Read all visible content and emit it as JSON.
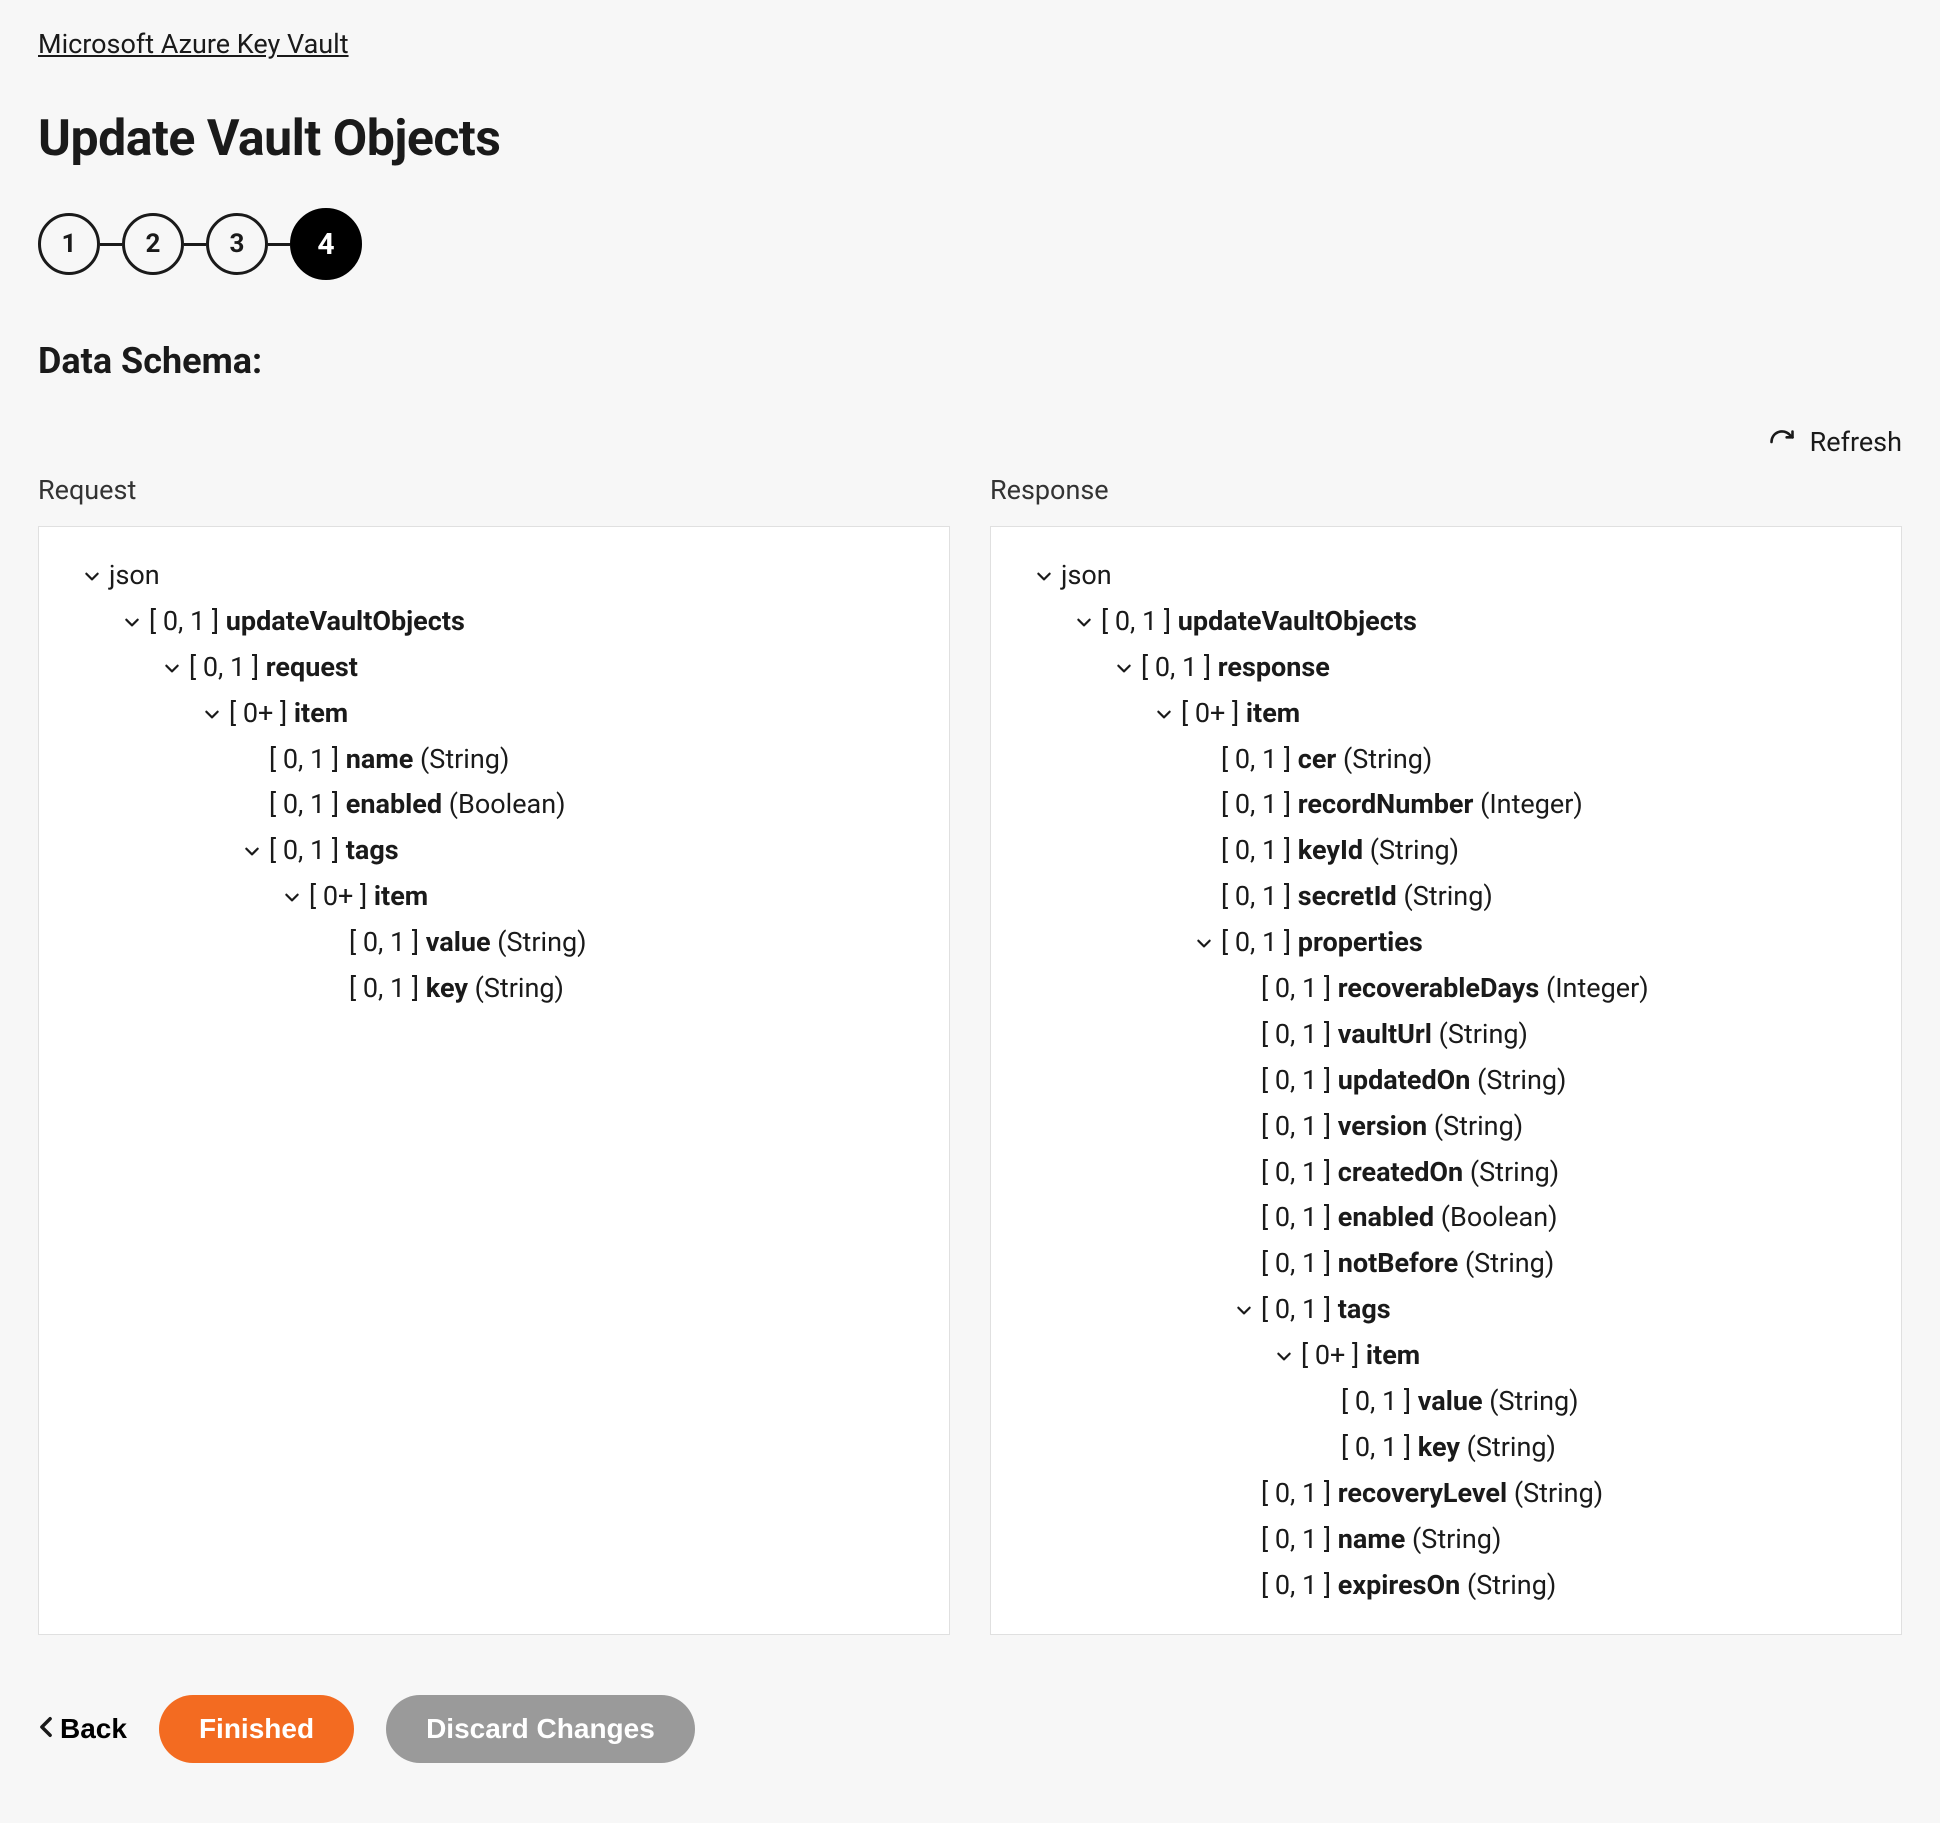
{
  "breadcrumb": "Microsoft Azure Key Vault",
  "page_title": "Update Vault Objects",
  "stepper": {
    "steps": [
      "1",
      "2",
      "3",
      "4"
    ],
    "active_index": 3
  },
  "section_heading": "Data Schema:",
  "refresh_label": "Refresh",
  "columns": {
    "request": {
      "header": "Request",
      "tree": [
        {
          "indent": 0,
          "chevron": true,
          "card": "",
          "name": "json",
          "type": ""
        },
        {
          "indent": 1,
          "chevron": true,
          "card": "[ 0, 1 ]",
          "name": "updateVaultObjects",
          "type": ""
        },
        {
          "indent": 2,
          "chevron": true,
          "card": "[ 0, 1 ]",
          "name": "request",
          "type": ""
        },
        {
          "indent": 3,
          "chevron": true,
          "card": "[ 0+ ]",
          "name": "item",
          "type": ""
        },
        {
          "indent": 4,
          "chevron": false,
          "card": "[ 0, 1 ]",
          "name": "name",
          "type": "(String)"
        },
        {
          "indent": 4,
          "chevron": false,
          "card": "[ 0, 1 ]",
          "name": "enabled",
          "type": "(Boolean)"
        },
        {
          "indent": 4,
          "chevron": true,
          "card": "[ 0, 1 ]",
          "name": "tags",
          "type": ""
        },
        {
          "indent": 5,
          "chevron": true,
          "card": "[ 0+ ]",
          "name": "item",
          "type": ""
        },
        {
          "indent": 6,
          "chevron": false,
          "card": "[ 0, 1 ]",
          "name": "value",
          "type": "(String)"
        },
        {
          "indent": 6,
          "chevron": false,
          "card": "[ 0, 1 ]",
          "name": "key",
          "type": "(String)"
        }
      ]
    },
    "response": {
      "header": "Response",
      "tree": [
        {
          "indent": 0,
          "chevron": true,
          "card": "",
          "name": "json",
          "type": ""
        },
        {
          "indent": 1,
          "chevron": true,
          "card": "[ 0, 1 ]",
          "name": "updateVaultObjects",
          "type": ""
        },
        {
          "indent": 2,
          "chevron": true,
          "card": "[ 0, 1 ]",
          "name": "response",
          "type": ""
        },
        {
          "indent": 3,
          "chevron": true,
          "card": "[ 0+ ]",
          "name": "item",
          "type": ""
        },
        {
          "indent": 4,
          "chevron": false,
          "card": "[ 0, 1 ]",
          "name": "cer",
          "type": "(String)"
        },
        {
          "indent": 4,
          "chevron": false,
          "card": "[ 0, 1 ]",
          "name": "recordNumber",
          "type": "(Integer)"
        },
        {
          "indent": 4,
          "chevron": false,
          "card": "[ 0, 1 ]",
          "name": "keyId",
          "type": "(String)"
        },
        {
          "indent": 4,
          "chevron": false,
          "card": "[ 0, 1 ]",
          "name": "secretId",
          "type": "(String)"
        },
        {
          "indent": 4,
          "chevron": true,
          "card": "[ 0, 1 ]",
          "name": "properties",
          "type": ""
        },
        {
          "indent": 5,
          "chevron": false,
          "card": "[ 0, 1 ]",
          "name": "recoverableDays",
          "type": "(Integer)"
        },
        {
          "indent": 5,
          "chevron": false,
          "card": "[ 0, 1 ]",
          "name": "vaultUrl",
          "type": "(String)"
        },
        {
          "indent": 5,
          "chevron": false,
          "card": "[ 0, 1 ]",
          "name": "updatedOn",
          "type": "(String)"
        },
        {
          "indent": 5,
          "chevron": false,
          "card": "[ 0, 1 ]",
          "name": "version",
          "type": "(String)"
        },
        {
          "indent": 5,
          "chevron": false,
          "card": "[ 0, 1 ]",
          "name": "createdOn",
          "type": "(String)"
        },
        {
          "indent": 5,
          "chevron": false,
          "card": "[ 0, 1 ]",
          "name": "enabled",
          "type": "(Boolean)"
        },
        {
          "indent": 5,
          "chevron": false,
          "card": "[ 0, 1 ]",
          "name": "notBefore",
          "type": "(String)"
        },
        {
          "indent": 5,
          "chevron": true,
          "card": "[ 0, 1 ]",
          "name": "tags",
          "type": ""
        },
        {
          "indent": 6,
          "chevron": true,
          "card": "[ 0+ ]",
          "name": "item",
          "type": ""
        },
        {
          "indent": 7,
          "chevron": false,
          "card": "[ 0, 1 ]",
          "name": "value",
          "type": "(String)"
        },
        {
          "indent": 7,
          "chevron": false,
          "card": "[ 0, 1 ]",
          "name": "key",
          "type": "(String)"
        },
        {
          "indent": 5,
          "chevron": false,
          "card": "[ 0, 1 ]",
          "name": "recoveryLevel",
          "type": "(String)"
        },
        {
          "indent": 5,
          "chevron": false,
          "card": "[ 0, 1 ]",
          "name": "name",
          "type": "(String)"
        },
        {
          "indent": 5,
          "chevron": false,
          "card": "[ 0, 1 ]",
          "name": "expiresOn",
          "type": "(String)"
        }
      ]
    }
  },
  "footer": {
    "back": "Back",
    "finished": "Finished",
    "discard": "Discard Changes"
  }
}
